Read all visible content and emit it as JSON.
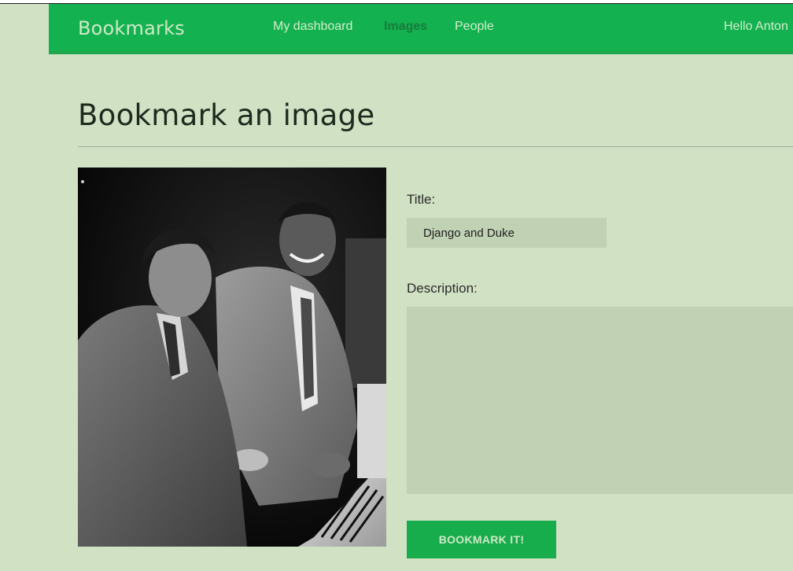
{
  "navbar": {
    "brand": "Bookmarks",
    "items": [
      {
        "label": "My dashboard",
        "active": false
      },
      {
        "label": "Images",
        "active": true
      },
      {
        "label": "People",
        "active": false
      }
    ],
    "greeting": "Hello Anton"
  },
  "page": {
    "title": "Bookmark an image"
  },
  "form": {
    "title_label": "Title:",
    "title_value": "Django and Duke",
    "description_label": "Description:",
    "description_value": "",
    "submit_label": "BOOKMARK IT!"
  },
  "colors": {
    "brand_green": "#13b150",
    "active_nav": "#1a7b3c",
    "page_background": "#d1e1c4",
    "input_background": "#c0d2b3"
  }
}
